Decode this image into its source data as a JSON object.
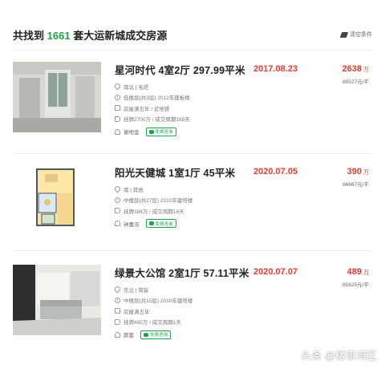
{
  "header": {
    "prefix": "共找到",
    "count": "1661",
    "suffix": "套大运新城成交房源",
    "clear_filter": "清空条件"
  },
  "colors": {
    "accent": "#1ea24a",
    "price": "#e8382f"
  },
  "listings": [
    {
      "title": "星河时代 4室2厅 297.99平米",
      "location": "南北 | 毛坯",
      "floor": "低楼层(共3层) 2012年建板楼",
      "tag": "房屋满五年 / 近地铁",
      "history": "挂牌2700万 / 成交周期168天",
      "agent": "谢地金",
      "consult_label": "免费咨询",
      "date": "2017.08.23",
      "total_price": "2638",
      "price_unit": "万",
      "unit_price": "88527元/平"
    },
    {
      "title": "阳光天健城 1室1厅 45平米",
      "location": "南 | 其他",
      "floor": "中楼层(共27层) 2010年建塔楼",
      "history": "挂牌386万 / 成交周期18天",
      "agent": "钟嘉浩",
      "consult_label": "免费咨询",
      "date": "2020.07.05",
      "total_price": "390",
      "price_unit": "万",
      "unit_price": "86667元/平"
    },
    {
      "title": "绿景大公馆 2室1厅 57.11平米",
      "location": "东北 | 简装",
      "floor": "中楼层(共15层) 2010年建塔楼",
      "tag": "房屋满五年",
      "history": "挂牌485万 / 成交周期1天",
      "agent": "颜富",
      "consult_label": "免费咨询",
      "date": "2020.07.07",
      "total_price": "489",
      "price_unit": "万",
      "unit_price": "85625元/平"
    }
  ],
  "watermark": "头条 @楼事湾区"
}
